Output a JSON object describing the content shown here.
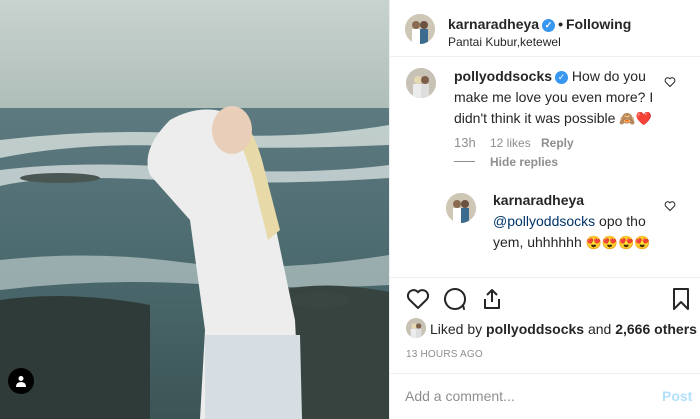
{
  "header": {
    "username": "karnaradheya",
    "dot": "•",
    "follow_label": "Following",
    "location": "Pantai Kubur,ketewel"
  },
  "comments": [
    {
      "username": "pollyoddsocks",
      "text": "How do you make me love you even more? I didn't think it was possible",
      "emoji": "🙈❤️",
      "time": "13h",
      "likes": "12 likes",
      "reply_label": "Reply"
    }
  ],
  "hide_replies_label": "Hide replies",
  "reply": {
    "username": "karnaradheya",
    "mention": "@pollyoddsocks",
    "text": "opo tho yem, uhhhhhh",
    "emoji": "😍😍😍😍"
  },
  "likes": {
    "prefix": "Liked by",
    "user": "pollyoddsocks",
    "connector": "and",
    "others": "2,666 others"
  },
  "timeago": "13 HOURS AGO",
  "add_comment": {
    "placeholder": "Add a comment...",
    "post_label": "Post"
  },
  "colors": {
    "verified": "#3897f0",
    "secondary_text": "#8e8e8e",
    "post_button": "#b2dffc"
  },
  "icons": [
    "user-tag-icon",
    "verified-icon",
    "heart-icon",
    "comment-icon",
    "share-icon",
    "bookmark-icon"
  ]
}
